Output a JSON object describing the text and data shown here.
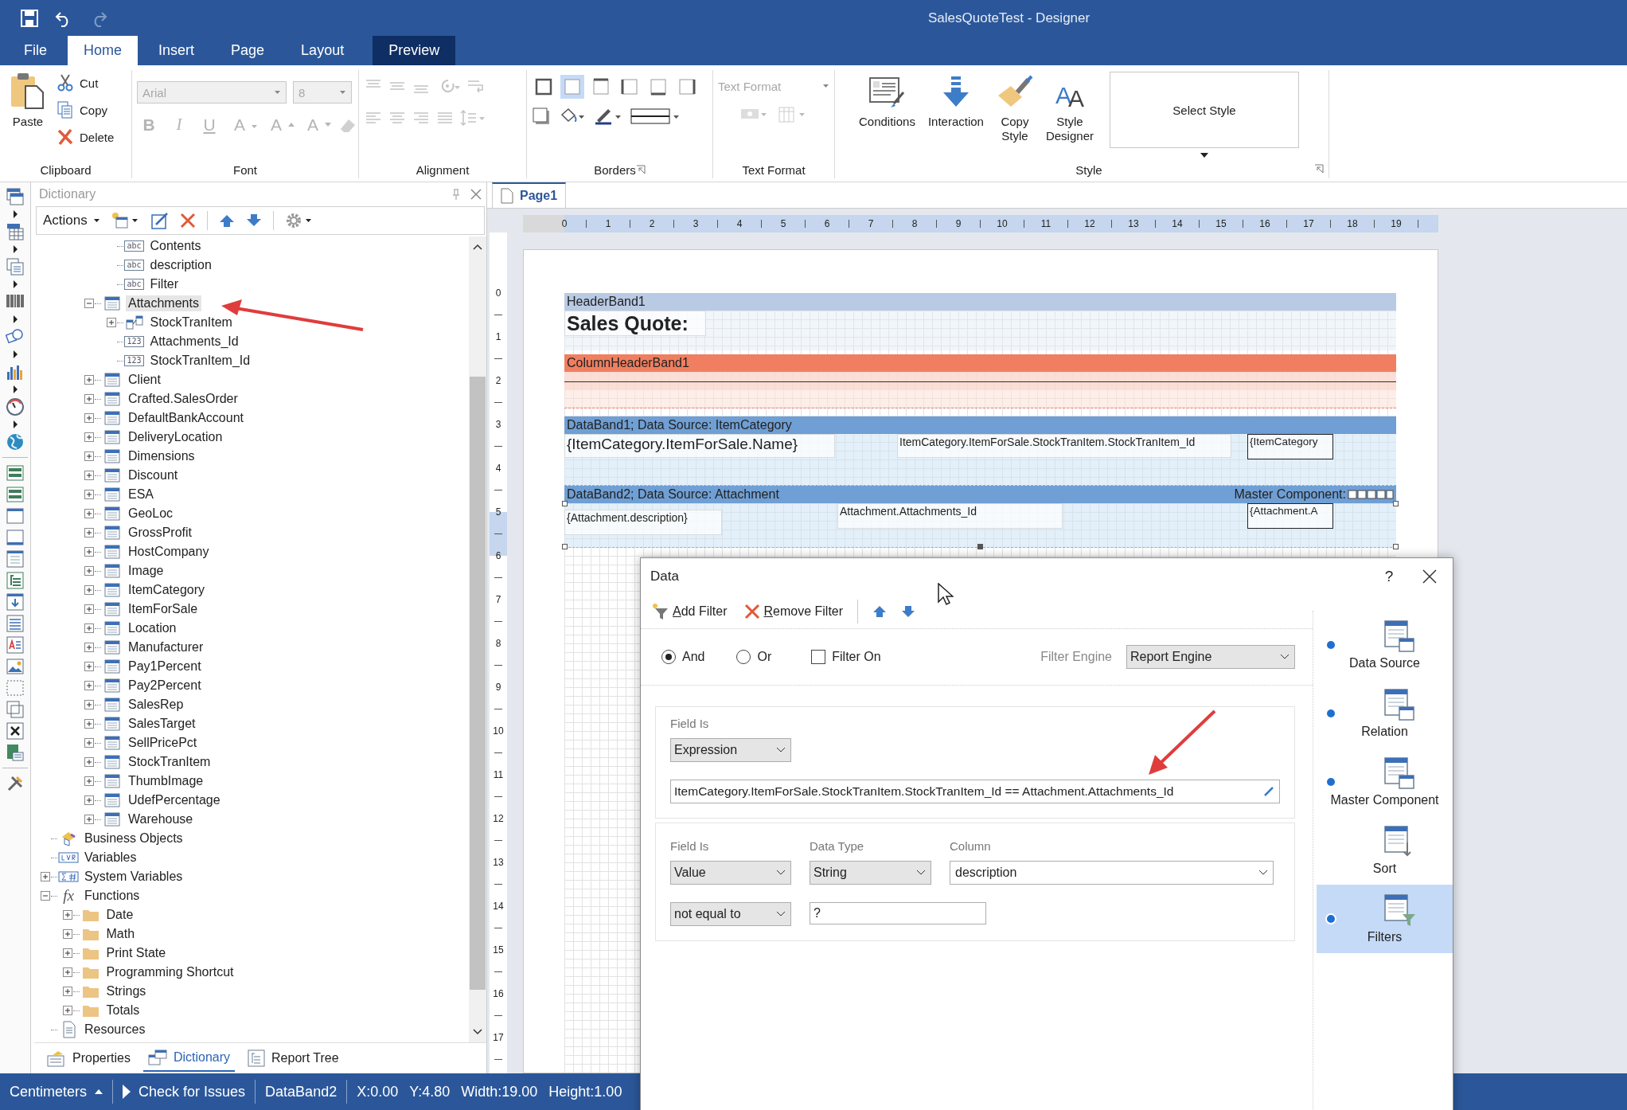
{
  "window": {
    "title": "SalesQuoteTest - Designer"
  },
  "ribbon_tabs": [
    {
      "label": "File",
      "selected": false,
      "kind": "backstage"
    },
    {
      "label": "Home",
      "selected": true,
      "kind": "normal"
    },
    {
      "label": "Insert",
      "selected": false,
      "kind": "normal"
    },
    {
      "label": "Page",
      "selected": false,
      "kind": "normal"
    },
    {
      "label": "Layout",
      "selected": false,
      "kind": "normal"
    },
    {
      "label": "Preview",
      "selected": false,
      "kind": "contextual"
    }
  ],
  "ribbon": {
    "clipboard": {
      "label": "Clipboard",
      "paste": "Paste",
      "cut": "Cut",
      "copy": "Copy",
      "delete": "Delete"
    },
    "font": {
      "label": "Font",
      "disabled": true,
      "font_name": "Arial",
      "font_size": "8",
      "format_buttons": [
        {
          "label": "B",
          "kind": "bold"
        },
        {
          "label": "I",
          "kind": "italic"
        },
        {
          "label": "U",
          "kind": "underline"
        },
        {
          "label": "A",
          "kind": "color"
        },
        {
          "label": "A",
          "kind": "grow"
        },
        {
          "label": "A",
          "kind": "shrink"
        }
      ]
    },
    "alignment": {
      "label": "Alignment",
      "disabled": true
    },
    "borders": {
      "label": "Borders",
      "border_buttons": [
        {
          "kind": "all",
          "selected": false
        },
        {
          "kind": "none",
          "selected": true
        },
        {
          "kind": "top",
          "selected": false
        },
        {
          "kind": "left",
          "selected": false
        },
        {
          "kind": "bottom",
          "selected": false
        },
        {
          "kind": "right",
          "selected": false
        }
      ]
    },
    "text_format": {
      "label": "Text Format",
      "disabled": true,
      "placeholder": "Text Format"
    },
    "style": {
      "label": "Style",
      "buttons": [
        {
          "label": "Conditions",
          "kind": "conditions"
        },
        {
          "label": "Interaction",
          "kind": "interaction"
        },
        {
          "label": "Copy\nStyle",
          "kind": "copy_style"
        },
        {
          "label": "Style\nDesigner",
          "kind": "style_designer",
          "glyphs": [
            "A",
            "A"
          ]
        }
      ],
      "select_style": "Select Style"
    }
  },
  "dictionary": {
    "title": "Dictionary",
    "actions": "Actions",
    "tree": [
      {
        "children": [
          {
            "children": [
              {
                "children": [
                  {
                    "label": "Contents",
                    "kind": "text_column",
                    "symbol": "abc",
                    "selected": false
                  },
                  {
                    "label": "description",
                    "kind": "text_column",
                    "symbol": "abc",
                    "selected": false
                  },
                  {
                    "label": "Filter",
                    "kind": "text_column",
                    "symbol": "abc",
                    "selected": false
                  }
                ]
              },
              {
                "label": "Attachments",
                "kind": "table",
                "expanded": true,
                "selected": true,
                "children": [
                  {
                    "label": "StockTranItem",
                    "kind": "relation",
                    "expanded": false,
                    "selected": false
                  },
                  {
                    "label": "Attachments_Id",
                    "kind": "number_column",
                    "symbol": "123",
                    "selected": false
                  },
                  {
                    "label": "StockTranItem_Id",
                    "kind": "number_column",
                    "symbol": "123",
                    "selected": false
                  }
                ]
              },
              {
                "label": "Client",
                "kind": "table",
                "expanded": false,
                "selected": false
              },
              {
                "label": "Crafted.SalesOrder",
                "kind": "table",
                "expanded": false,
                "selected": false
              },
              {
                "label": "DefaultBankAccount",
                "kind": "table",
                "expanded": false,
                "selected": false
              },
              {
                "label": "DeliveryLocation",
                "kind": "table",
                "expanded": false,
                "selected": false
              },
              {
                "label": "Dimensions",
                "kind": "table",
                "expanded": false,
                "selected": false
              },
              {
                "label": "Discount",
                "kind": "table",
                "expanded": false,
                "selected": false
              },
              {
                "label": "ESA",
                "kind": "table",
                "expanded": false,
                "selected": false
              },
              {
                "label": "GeoLoc",
                "kind": "table",
                "expanded": false,
                "selected": false
              },
              {
                "label": "GrossProfit",
                "kind": "table",
                "expanded": false,
                "selected": false
              },
              {
                "label": "HostCompany",
                "kind": "table",
                "expanded": false,
                "selected": false
              },
              {
                "label": "Image",
                "kind": "table",
                "expanded": false,
                "selected": false
              },
              {
                "label": "ItemCategory",
                "kind": "table",
                "expanded": false,
                "selected": false
              },
              {
                "label": "ItemForSale",
                "kind": "table",
                "expanded": false,
                "selected": false
              },
              {
                "label": "Location",
                "kind": "table",
                "expanded": false,
                "selected": false
              },
              {
                "label": "Manufacturer",
                "kind": "table",
                "expanded": false,
                "selected": false
              },
              {
                "label": "Pay1Percent",
                "kind": "table",
                "expanded": false,
                "selected": false
              },
              {
                "label": "Pay2Percent",
                "kind": "table",
                "expanded": false,
                "selected": false
              },
              {
                "label": "SalesRep",
                "kind": "table",
                "expanded": false,
                "selected": false
              },
              {
                "label": "SalesTarget",
                "kind": "table",
                "expanded": false,
                "selected": false
              },
              {
                "label": "SellPricePct",
                "kind": "table",
                "expanded": false,
                "selected": false
              },
              {
                "label": "StockTranItem",
                "kind": "table",
                "expanded": false,
                "selected": false
              },
              {
                "label": "ThumbImage",
                "kind": "table",
                "expanded": false,
                "selected": false
              },
              {
                "label": "UdefPercentage",
                "kind": "table",
                "expanded": false,
                "selected": false
              },
              {
                "label": "Warehouse",
                "kind": "table",
                "expanded": false,
                "selected": false
              }
            ]
          }
        ]
      },
      {
        "label": "Business Objects",
        "kind": "business_objects",
        "selected": false
      },
      {
        "label": "Variables",
        "kind": "variables",
        "selected": false
      },
      {
        "label": "System Variables",
        "kind": "system_variables",
        "expanded": false,
        "selected": false
      },
      {
        "label": "Functions",
        "kind": "functions",
        "symbol": "fx",
        "expanded": true,
        "selected": false,
        "children": [
          {
            "label": "Date",
            "kind": "folder",
            "expanded": false,
            "selected": false
          },
          {
            "label": "Math",
            "kind": "folder",
            "expanded": false,
            "selected": false
          },
          {
            "label": "Print State",
            "kind": "folder",
            "expanded": false,
            "selected": false
          },
          {
            "label": "Programming Shortcut",
            "kind": "folder",
            "expanded": false,
            "selected": false
          },
          {
            "label": "Strings",
            "kind": "folder",
            "expanded": false,
            "selected": false
          },
          {
            "label": "Totals",
            "kind": "folder",
            "expanded": false,
            "selected": false
          }
        ]
      },
      {
        "label": "Resources",
        "kind": "resources",
        "selected": false
      }
    ],
    "bottom_tabs": [
      {
        "label": "Properties",
        "kind": "properties",
        "selected": false
      },
      {
        "label": "Dictionary",
        "kind": "dictionary",
        "selected": true
      },
      {
        "label": "Report Tree",
        "kind": "report_tree",
        "selected": false
      }
    ]
  },
  "designer": {
    "page_tabs": [
      {
        "label": "Page1",
        "selected": true
      }
    ],
    "ruler_h": [
      "0",
      "1",
      "2",
      "3",
      "4",
      "5",
      "6",
      "7",
      "8",
      "9",
      "10",
      "11",
      "12",
      "13",
      "14",
      "15",
      "16",
      "17",
      "18",
      "19"
    ],
    "ruler_v": [
      {
        "label": "0",
        "selected": false
      },
      {
        "label": "1",
        "selected": false
      },
      {
        "label": "2",
        "selected": false
      },
      {
        "label": "3",
        "selected": false
      },
      {
        "label": "4",
        "selected": false
      },
      {
        "label": "5",
        "selected": true
      },
      {
        "label": "6",
        "selected": false
      },
      {
        "label": "7",
        "selected": false
      },
      {
        "label": "8",
        "selected": false
      },
      {
        "label": "9",
        "selected": false
      },
      {
        "label": "10",
        "selected": false
      },
      {
        "label": "11",
        "selected": false
      },
      {
        "label": "12",
        "selected": false
      },
      {
        "label": "13",
        "selected": false
      },
      {
        "label": "14",
        "selected": false
      },
      {
        "label": "15",
        "selected": false
      },
      {
        "label": "16",
        "selected": false
      },
      {
        "label": "17",
        "selected": false
      }
    ],
    "bands": [
      {
        "kind": "header",
        "title": "HeaderBand1",
        "selected": false,
        "components": [
          {
            "text": "Sales Quote:",
            "kind": "title"
          }
        ]
      },
      {
        "kind": "column_header",
        "title": "ColumnHeaderBand1",
        "selected": false
      },
      {
        "kind": "data",
        "title": "DataBand1; Data Source: ItemCategory",
        "selected": false,
        "components": [
          {
            "text": "{ItemCategory.ItemForSale.Name}",
            "kind": "large"
          },
          {
            "text": "ItemCategory.ItemForSale.StockTranItem.StockTranItem_Id",
            "kind": "plain"
          },
          {
            "text": "{ItemCategory",
            "kind": "boxed"
          }
        ]
      },
      {
        "kind": "data",
        "title": "DataBand2; Data Source: Attachment",
        "master_label": "Master Component:",
        "selected": true,
        "components": [
          {
            "text": "{Attachment.description}",
            "kind": "plain"
          },
          {
            "text": "Attachment.Attachments_Id",
            "kind": "plain"
          },
          {
            "text": "{Attachment.A",
            "kind": "boxed"
          }
        ]
      }
    ]
  },
  "dialog": {
    "title": "Data",
    "help": "?",
    "add_filter": "Add Filter",
    "remove_filter": "Remove Filter",
    "logic": [
      {
        "label": "And",
        "selected": true
      },
      {
        "label": "Or",
        "selected": false
      }
    ],
    "filter_on": {
      "label": "Filter On",
      "checked": false
    },
    "filter_engine": {
      "label": "Filter Engine",
      "value": "Report Engine"
    },
    "filters": [
      {
        "kind": "expression",
        "field_is_label": "Field Is",
        "field_is": "Expression",
        "expression": "ItemCategory.ItemForSale.StockTranItem.StockTranItem_Id == Attachment.Attachments_Id"
      },
      {
        "kind": "value",
        "field_is_label": "Field Is",
        "field_is": "Value",
        "data_type_label": "Data Type",
        "data_type": "String",
        "column_label": "Column",
        "column": "description",
        "condition": "not equal to",
        "value": "?"
      }
    ],
    "nav": [
      {
        "label": "Data Source",
        "marked": true,
        "selected": false
      },
      {
        "label": "Relation",
        "marked": true,
        "selected": false
      },
      {
        "label": "Master Component",
        "marked": true,
        "selected": false
      },
      {
        "label": "Sort",
        "marked": false,
        "selected": false
      },
      {
        "label": "Filters",
        "marked": true,
        "selected": true
      }
    ]
  },
  "status_bar": {
    "units": "Centimeters",
    "check": "Check for Issues",
    "component": "DataBand2",
    "x": "X:0.00",
    "y": "Y:4.80",
    "width": "Width:19.00",
    "height": "Height:1.00"
  }
}
